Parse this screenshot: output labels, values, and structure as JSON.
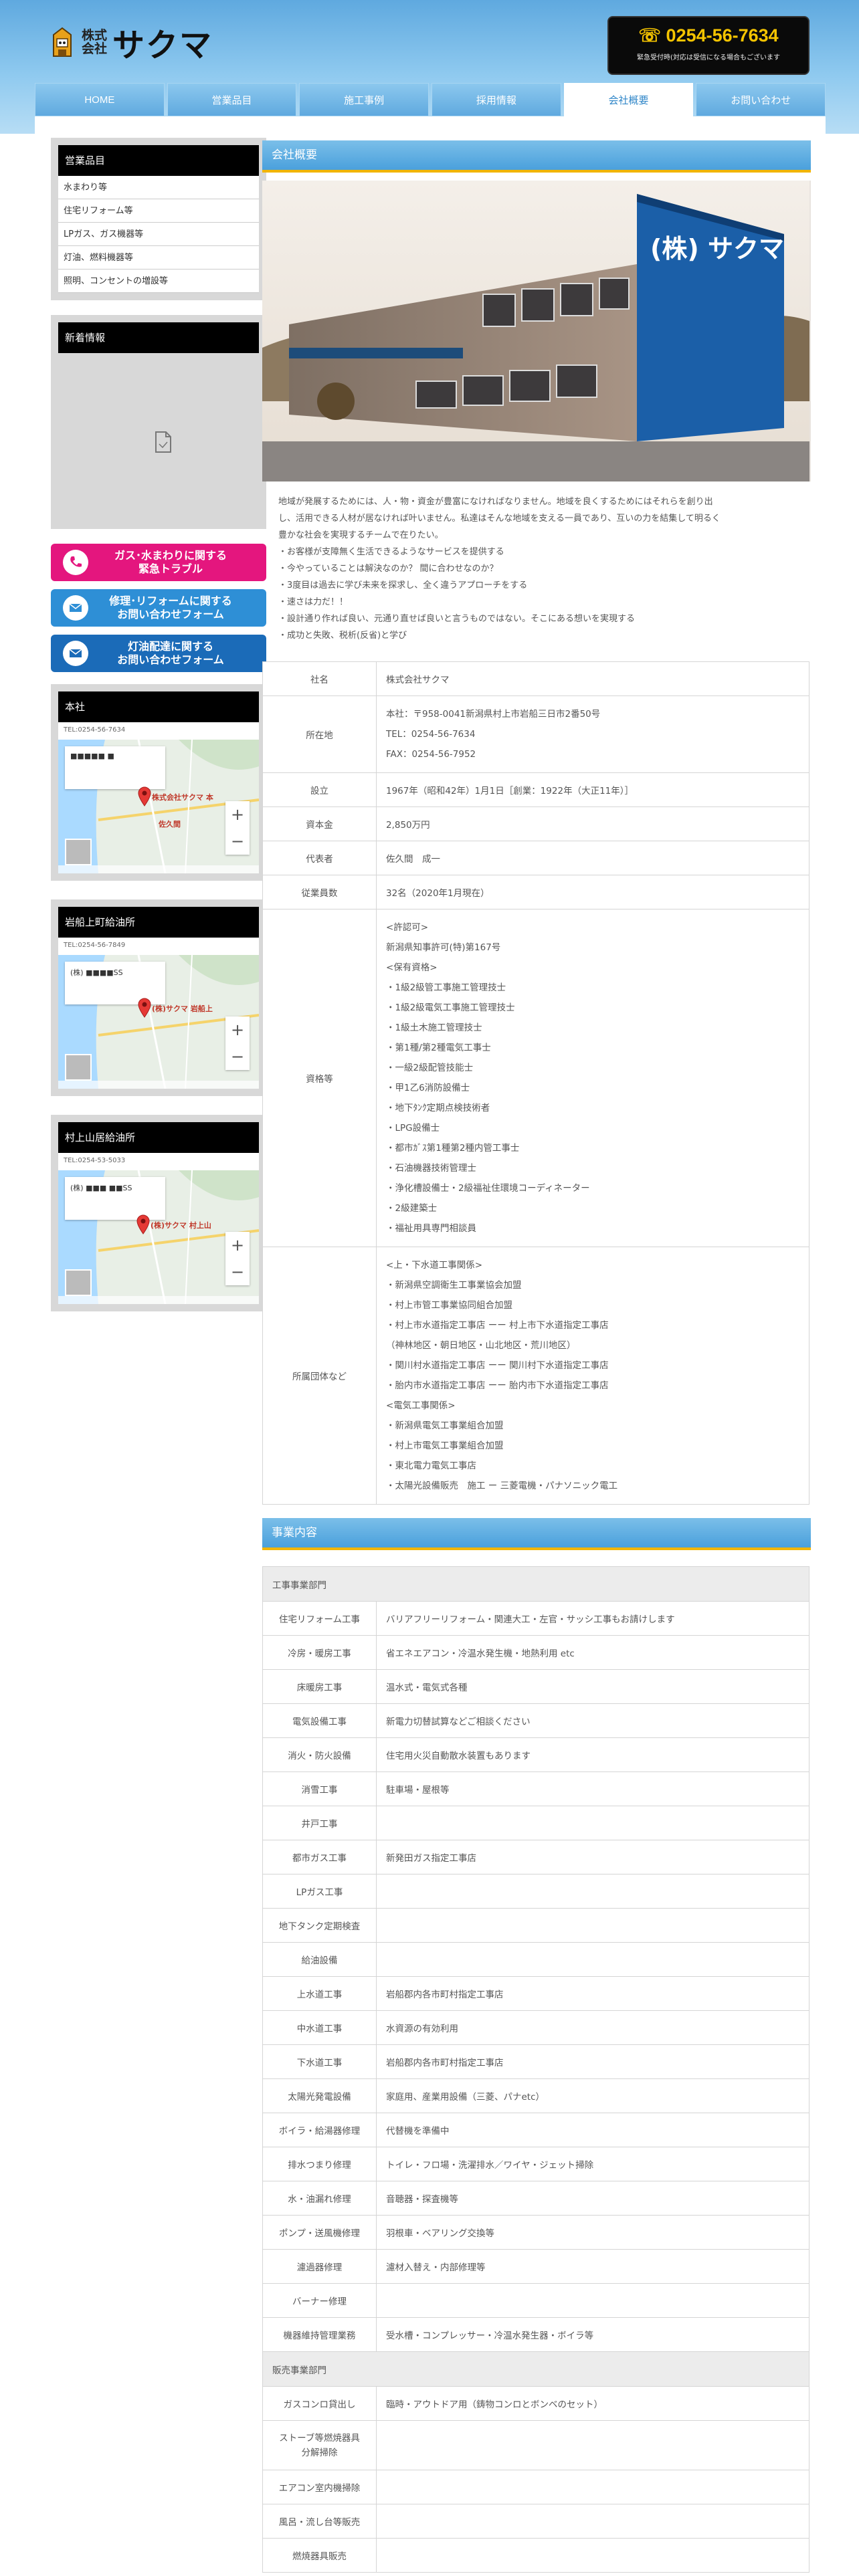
{
  "header": {
    "logo_small_top": "株式",
    "logo_small_bottom": "会社",
    "logo_name": "サクマ",
    "tel_number": "0254-56-7634",
    "tel_note": "緊急受付時(対応は受信になる場合もございます"
  },
  "nav": [
    "HOME",
    "営業品目",
    "施工事例",
    "採用情報",
    "会社概要",
    "お問い合わせ"
  ],
  "nav_active_index": 4,
  "sidebar": {
    "products_title": "営業品目",
    "products": [
      "水まわり等",
      "住宅リフォーム等",
      "LPガス、ガス機器等",
      "灯油、燃料機器等",
      "照明、コンセントの増設等"
    ],
    "news_title": "新着情報",
    "cta": [
      {
        "line1": "ガス･水まわりに関する",
        "line2": "緊急トラブル",
        "color": "#e4167e"
      },
      {
        "line1": "修理･リフォームに関する",
        "line2": "お問い合わせフォーム",
        "color": "#2e8fd6"
      },
      {
        "line1": "灯油配達に関する",
        "line2": "お問い合わせフォーム",
        "color": "#1b6bb8"
      }
    ],
    "offices": [
      {
        "title": "本社",
        "tel": "TEL:0254-56-7634",
        "map_card": "■■■■■ ■",
        "map_label": "株式会社サクマ 本",
        "map_label2": "佐久間"
      },
      {
        "title": "岩船上町給油所",
        "tel": "TEL:0254-56-7849",
        "map_card": "(株) ■■■■SS",
        "map_label": "(株)サクマ 岩船上",
        "map_label2": ""
      },
      {
        "title": "村上山居給油所",
        "tel": "TEL:0254-53-5033",
        "map_card": "(株) ■■■ ■■SS",
        "map_label": "(株)サクマ 村上山",
        "map_label2": ""
      }
    ]
  },
  "company": {
    "section_title": "会社概要",
    "building_sign": "(株) サクマ",
    "intro": [
      "地域が発展するためには、人・物・資金が豊富になければなりません。地域を良くするためにはそれらを創り出",
      "し、活用できる人材が居なければ叶いません。私達はそんな地域を支える一員であり、互いの力を結集して明るく",
      "豊かな社会を実現するチームで在りたい。",
      "・お客様が支障無く生活できるようなサービスを提供する",
      "・今やっていることは解決なのか？ 間に合わせなのか？",
      "・3度目は過去に学び未来を探求し、全く違うアプローチをする",
      "・速さは力だ！！",
      "・設計通り作れば良い、元通り直せば良いと言うものではない。そこにある想いを実現する",
      "・成功と失敗、税析(反省)と学び"
    ],
    "rows": [
      {
        "label": "社名",
        "lines": [
          "株式会社サクマ"
        ]
      },
      {
        "label": "所在地",
        "lines": [
          "本社：〒958-0041新潟県村上市岩船三日市2番50号",
          "TEL：0254-56-7634",
          "FAX：0254-56-7952"
        ]
      },
      {
        "label": "設立",
        "lines": [
          "1967年（昭和42年）1月1日［創業：1922年（大正11年）］"
        ]
      },
      {
        "label": "資本金",
        "lines": [
          "2,850万円"
        ]
      },
      {
        "label": "代表者",
        "lines": [
          "佐久間　成一"
        ]
      },
      {
        "label": "従業員数",
        "lines": [
          "32名（2020年1月現在）"
        ]
      },
      {
        "label": "資格等",
        "lines": [
          "<許認可>",
          "新潟県知事許可(特)第167号",
          "<保有資格>",
          "・1級2級管工事施工管理技士",
          "・1級2級電気工事施工管理技士",
          "・1級土木施工管理技士",
          "・第1種/第2種電気工事士",
          "・一級2級配管技能士",
          "・甲1乙6消防設備士",
          "・地下ﾀﾝｸ定期点検技術者",
          "・LPG設備士",
          "・都市ｶﾞｽ第1種第2種内管工事士",
          "・石油機器技術管理士",
          "・浄化槽設備士・2級福祉住環境コーディネーター",
          "・2級建築士",
          "・福祉用具専門相談員"
        ]
      },
      {
        "label": "所属団体など",
        "lines": [
          "<上・下水道工事関係>",
          "・新潟県空調衛生工事業協会加盟",
          "・村上市管工事業協同組合加盟",
          "・村上市水道指定工事店 ーー 村上市下水道指定工事店",
          "（神林地区・朝日地区・山北地区・荒川地区）",
          "・関川村水道指定工事店 ーー 関川村下水道指定工事店",
          "・胎内市水道指定工事店 ーー 胎内市下水道指定工事店",
          "<電気工事関係>",
          "・新潟県電気工事業組合加盟",
          "・村上市電気工事業組合加盟",
          "・東北電力電気工事店",
          "・太陽光設備販売　施工 ー 三菱電機・パナソニック電工"
        ]
      }
    ]
  },
  "business": {
    "section_title": "事業内容",
    "groups": [
      {
        "title": "工事事業部門",
        "rows": [
          [
            "住宅リフォーム工事",
            "バリアフリーリフォーム・関連大工・左官・サッシ工事もお請けします"
          ],
          [
            "冷房・暖房工事",
            "省エネエアコン・冷温水発生機・地熱利用 etc"
          ],
          [
            "床暖房工事",
            "温水式・電気式各種"
          ],
          [
            "電気設備工事",
            "新電力切替試算などご相談ください"
          ],
          [
            "消火・防火設備",
            "住宅用火災自動散水装置もあります"
          ],
          [
            "消雪工事",
            "駐車場・屋根等"
          ],
          [
            "井戸工事",
            ""
          ],
          [
            "都市ガス工事",
            "新発田ガス指定工事店"
          ],
          [
            "LPガス工事",
            ""
          ],
          [
            "地下タンク定期検査",
            ""
          ],
          [
            "給油設備",
            ""
          ],
          [
            "上水道工事",
            "岩船郡内各市町村指定工事店"
          ],
          [
            "中水道工事",
            "水資源の有効利用"
          ],
          [
            "下水道工事",
            "岩船郡内各市町村指定工事店"
          ],
          [
            "太陽光発電設備",
            "家庭用、産業用設備（三菱、パナetc）"
          ],
          [
            "ボイラ・給湯器修理",
            "代替機を準備中"
          ],
          [
            "排水つまり修理",
            "トイレ・フロ場・洗濯排水／ワイヤ・ジェット掃除"
          ],
          [
            "水・油漏れ修理",
            "音聴器・探査機等"
          ],
          [
            "ポンプ・送風機修理",
            "羽根車・ベアリング交換等"
          ],
          [
            "濾過器修理",
            "濾材入替え・内部修理等"
          ],
          [
            "バーナー修理",
            ""
          ],
          [
            "機器維持管理業務",
            "受水槽・コンプレッサー・冷温水発生器・ボイラ等"
          ]
        ]
      },
      {
        "title": "販売事業部門",
        "rows": [
          [
            "ガスコンロ貸出し",
            "臨時・アウトドア用（鋳物コンロとボンベのセット）"
          ],
          [
            "ストーブ等燃焼器具|分解掃除",
            ""
          ],
          [
            "エアコン室内機掃除",
            ""
          ],
          [
            "風呂・流し台等販売",
            ""
          ],
          [
            "燃焼器具販売",
            ""
          ]
        ]
      }
    ]
  }
}
